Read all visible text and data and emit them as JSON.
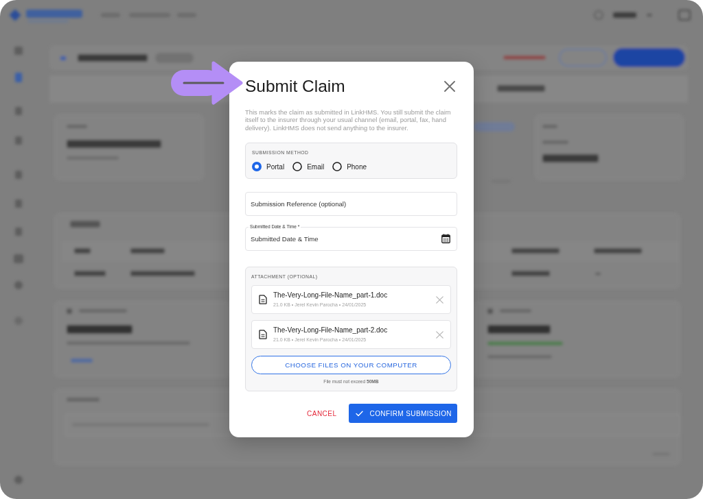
{
  "dialog": {
    "title": "Submit Claim",
    "description": "This marks the claim as submitted in LinkHMS. You still submit the claim itself to the insurer through your usual channel (email, portal, fax, hand delivery). LinkHMS does not send anything to the insurer.",
    "submission_method": {
      "label": "SUBMISSION METHOD",
      "options": [
        {
          "label": "Portal",
          "selected": true
        },
        {
          "label": "Email",
          "selected": false
        },
        {
          "label": "Phone",
          "selected": false
        }
      ]
    },
    "reference_field": {
      "placeholder": "Submission Reference (optional)"
    },
    "date_field": {
      "label": "Submitted Date & Time *",
      "placeholder": "Submitted Date & Time"
    },
    "attachments": {
      "label": "ATTACHMENT (OPTIONAL)",
      "files": [
        {
          "name": "The-Very-Long-File-Name_part-1.doc",
          "meta": "21.0 KB • Jerel Kevin Parocha • 24/01/2025"
        },
        {
          "name": "The-Very-Long-File-Name_part-2.doc",
          "meta": "21.0 KB • Jerel Kevin Parocha • 24/01/2025"
        }
      ],
      "choose_button": "CHOOSE FILES ON YOUR COMPUTER",
      "note": "File must not exceed **50MB**"
    },
    "buttons": [
      {
        "label": "CANCEL",
        "kind": "text"
      },
      {
        "label": "CONFIRM SUBMISSION",
        "kind": "primary"
      }
    ]
  }
}
